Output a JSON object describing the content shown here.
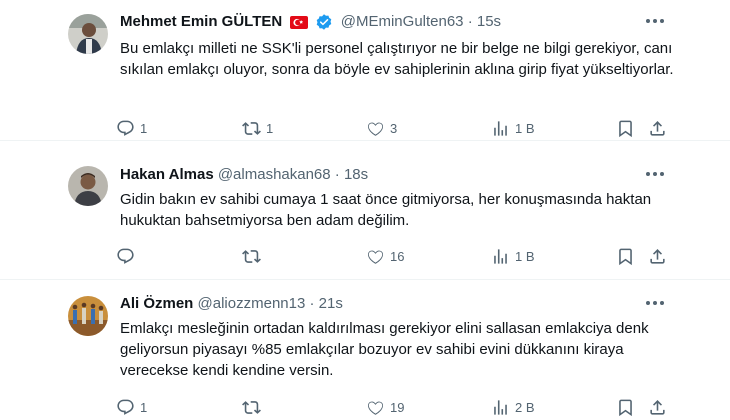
{
  "tweets": [
    {
      "name": "Mehmet Emin GÜLTEN",
      "handle": "@MEminGulten63",
      "dot": "·",
      "time": "15s",
      "has_flag": true,
      "verified": true,
      "text": "Bu emlakçı milleti ne SSK'li personel çalıştırıyor ne bir belge ne bilgi gerekiyor, canı sıkılan emlakçı oluyor, sonra da böyle ev sahiplerinin aklına girip fiyat yükseltiyorlar.",
      "replies": "1",
      "retweets": "1",
      "likes": "3",
      "views": "1 B"
    },
    {
      "name": "Hakan Almas",
      "handle": "@almashakan68",
      "dot": "·",
      "time": "18s",
      "text": "Gidin bakın ev sahibi cumaya 1 saat önce gitmiyorsa, her konuşmasında haktan hukuktan bahsetmiyorsa ben adam değilim.",
      "replies": "",
      "retweets": "",
      "likes": "16",
      "views": "1 B"
    },
    {
      "name": "Ali Özmen",
      "handle": "@aliozzmenn13",
      "dot": "·",
      "time": "21s",
      "text": "Emlakçı mesleğinin ortadan kaldırılması gerekiyor  elini sallasan emlakciya denk geliyorsun piyasayı %85 emlakçılar bozuyor ev sahibi evini dükkanını kiraya verecekse kendi kendine versin.",
      "replies": "1",
      "retweets": "",
      "likes": "19",
      "views": "2 B"
    }
  ],
  "colors": {
    "text": "#0f1419",
    "secondary": "#536471",
    "verified": "#1d9bf0",
    "flag": "#e30a17",
    "divider": "#eff3f4"
  },
  "icons": [
    "more-icon",
    "reply-icon",
    "retweet-icon",
    "like-icon",
    "views-icon",
    "bookmark-icon",
    "share-icon",
    "verified-icon",
    "turkey-flag-icon"
  ]
}
